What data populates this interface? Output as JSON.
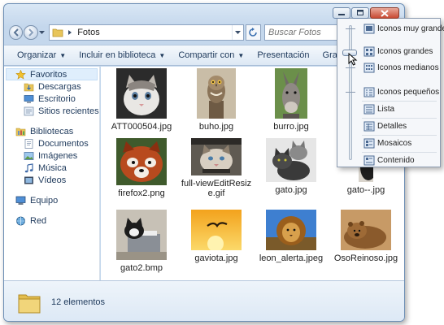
{
  "window": {
    "controls": {
      "minimize": "minimize",
      "maximize": "maximize",
      "close": "close"
    }
  },
  "address": {
    "path": "Fotos",
    "search_placeholder": "Buscar Fotos"
  },
  "toolbar": {
    "organize": "Organizar",
    "include_library": "Incluir en biblioteca",
    "share": "Compartir con",
    "slideshow": "Presentación",
    "burn": "Grabar",
    "more": "»"
  },
  "nav": {
    "favorites": "Favoritos",
    "downloads": "Descargas",
    "desktop": "Escritorio",
    "recent": "Sitios recientes",
    "libraries": "Bibliotecas",
    "documents": "Documentos",
    "images": "Imágenes",
    "music": "Música",
    "videos": "Vídeos",
    "computer": "Equipo",
    "network": "Red"
  },
  "files": [
    {
      "name": "ATT000504.jpg",
      "icon": "kitten-photo"
    },
    {
      "name": "buho.jpg",
      "icon": "owl-photo"
    },
    {
      "name": "burro.jpg",
      "icon": "donkey-photo"
    },
    {
      "name": "firefox2.png",
      "icon": "red-panda-photo"
    },
    {
      "name": "full-viewEditResize.gif",
      "icon": "cat-photo"
    },
    {
      "name": "gato.jpg",
      "icon": "cats-photo"
    },
    {
      "name": "gato--.jpg",
      "icon": "cat-dark-photo"
    },
    {
      "name": "gato2.bmp",
      "icon": "cat-printer-photo"
    },
    {
      "name": "gaviota.jpg",
      "icon": "seagull-photo"
    },
    {
      "name": "leon_alerta.jpeg",
      "icon": "lion-photo"
    },
    {
      "name": "OsoReinoso.jpg",
      "icon": "bear-photo"
    }
  ],
  "status": {
    "count": "12 elementos"
  },
  "view_menu": {
    "items": [
      "Iconos muy grandes",
      "Iconos grandes",
      "Iconos medianos",
      "Iconos pequeños",
      "Lista",
      "Detalles",
      "Mosaicos",
      "Contenido"
    ],
    "slider_level": "Iconos grandes"
  },
  "colors": {
    "accent": "#1e395b",
    "window_frame": "#c4d7ec",
    "selection": "#dfeefc"
  }
}
